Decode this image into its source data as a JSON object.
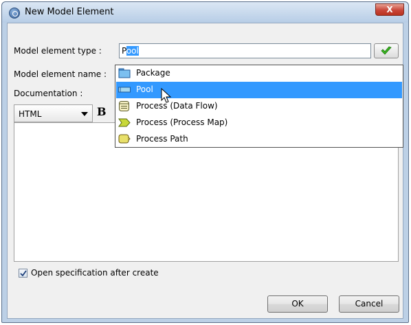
{
  "window": {
    "title": "New Model Element",
    "close_label": "X"
  },
  "form": {
    "type_label": "Model element type :",
    "type_value_typed": "P",
    "type_value_autocomplete": "ool",
    "name_label": "Model element name :",
    "documentation_label": "Documentation :"
  },
  "editor": {
    "format_value": "HTML",
    "bold_label": "B"
  },
  "dropdown": {
    "items": [
      {
        "label": "Package",
        "icon": "package-icon",
        "selected": false
      },
      {
        "label": "Pool",
        "icon": "pool-icon",
        "selected": true
      },
      {
        "label": "Process (Data Flow)",
        "icon": "process-data-flow-icon",
        "selected": false
      },
      {
        "label": "Process (Process Map)",
        "icon": "process-map-icon",
        "selected": false
      },
      {
        "label": "Process Path",
        "icon": "process-path-icon",
        "selected": false
      }
    ]
  },
  "options": {
    "open_spec_label": "Open specification after create",
    "open_spec_checked": true
  },
  "buttons": {
    "ok": "OK",
    "cancel": "Cancel"
  },
  "colors": {
    "selection": "#3399ff",
    "confirm_check": "#3cb521",
    "close_button": "#c9473a"
  }
}
